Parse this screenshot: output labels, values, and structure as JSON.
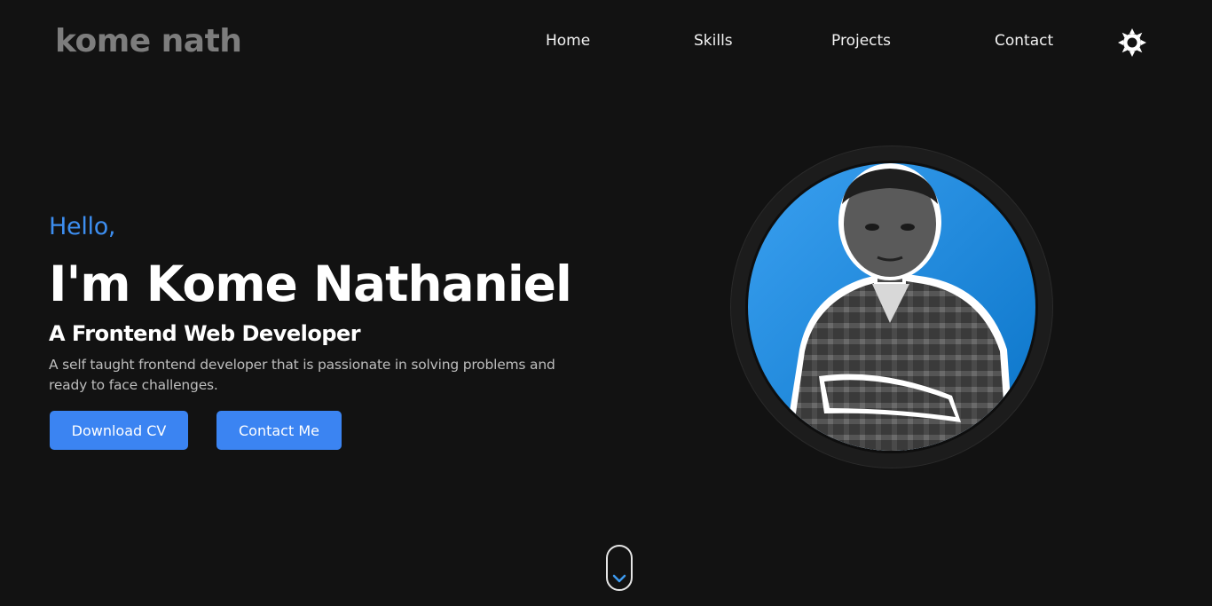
{
  "header": {
    "logo": "kome nath",
    "nav": {
      "home": "Home",
      "skills": "Skills",
      "projects": "Projects",
      "contact": "Contact"
    },
    "theme_icon": "sun-icon"
  },
  "hero": {
    "greeting": "Hello,",
    "name": "I'm Kome Nathaniel",
    "role": "A Frontend Web Developer",
    "bio": "A self taught frontend developer that is passionate in solving problems and ready to face challenges.",
    "buttons": {
      "download_cv": "Download CV",
      "contact_me": "Contact Me"
    }
  },
  "profile_image": {
    "icon": "profile-photo"
  },
  "scroll_indicator": {
    "icon": "chevron-down-icon"
  },
  "colors": {
    "background": "#121212",
    "accent": "#3b84f2",
    "greeting": "#3d8ef0",
    "logo": "#7d7d7d",
    "photo_bg": "#1e88e5"
  }
}
